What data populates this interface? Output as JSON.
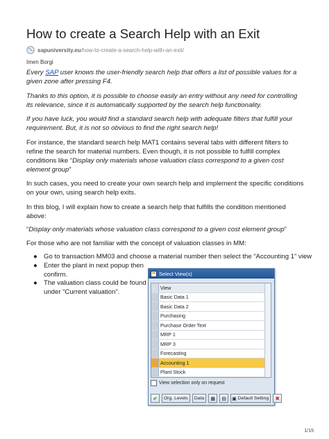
{
  "title": "How to create a Search Help with an Exit",
  "source": {
    "domain": "sapuniversity.eu",
    "path": "/how-to-create-a-search-help-with-an-exit/"
  },
  "author": "Imen Borgi",
  "intro": {
    "p1_a": "Every ",
    "p1_sap": "SAP",
    "p1_b": " user knows the user-friendly search help that offers a list of possible values for a given zone after pressing F4.",
    "p2": "Thanks to this option, it is possible to choose easily an entry without any need for controlling its relevance, since it is automatically supported by the search help functionality.",
    "p3": "If you have luck, you would find a standard search help with adequate filters that fulfill your requirement. But, it is not so obvious to find the right search help!"
  },
  "body": {
    "p4_a": "For instance, the standard search help MAT1 contains several tabs with different filters to refine the search for material numbers. Even though, it is not possible to fulfill complex conditions like “",
    "p4_i": "Display only materials whose valuation class correspond to a given cost element group",
    "p4_b": "”",
    "p5": "In such cases, you need to create your own search help and implement the specific conditions on your own, using search help exits.",
    "p6": "In this blog, I will explain how to create a search help that fulfills the condition mentioned above:",
    "p7_a": "“",
    "p7_i": "Display only materials whose valuation class correspond to a given cost element group",
    "p7_b": "”",
    "p8": "For those who are not familiar with the concept of valuation classes in MM:"
  },
  "bullets": [
    "Go to transaction MM03 and choose a material number then select the “Accounting 1” view",
    "Enter the plant in next popup then confirm.",
    "The valuation class could be found under “Current valuation”."
  ],
  "dialog": {
    "title": "Select View(s)",
    "header": "View",
    "views": [
      "Basic Data 1",
      "Basic Data 2",
      "Purchasing",
      "Purchase Order Text",
      "MRP 1",
      "MRP 3",
      "Forecasting",
      "Accounting 1",
      "Plant Stock"
    ],
    "highlighted": "Accounting 1",
    "checkbox_label": "View selection only on request",
    "btn_org": "Org. Levels",
    "btn_data": "Data",
    "btn_default": "Default Setting"
  },
  "page_number": "1/15"
}
